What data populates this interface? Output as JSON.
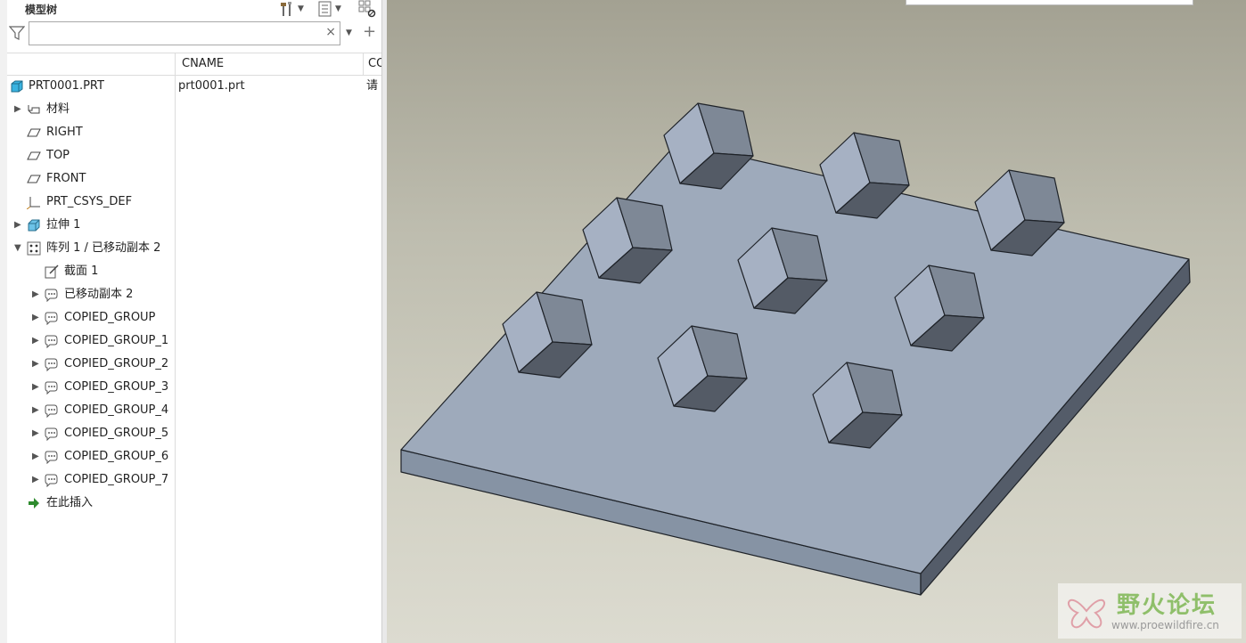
{
  "panel": {
    "title": "模型树"
  },
  "search": {
    "value": "",
    "placeholder": "",
    "clear": "×"
  },
  "columns": {
    "name": "",
    "cname": "CNAME",
    "third": "CO"
  },
  "tree": [
    {
      "label": "PRT0001.PRT",
      "cname": "prt0001.prt",
      "c2": "请",
      "icon": "part-icon",
      "indent": 0,
      "toggle": ""
    },
    {
      "label": "材料",
      "icon": "material-icon",
      "indent": 1,
      "toggle": "▶"
    },
    {
      "label": "RIGHT",
      "icon": "datum-plane-icon",
      "indent": 1,
      "toggle": ""
    },
    {
      "label": "TOP",
      "icon": "datum-plane-icon",
      "indent": 1,
      "toggle": ""
    },
    {
      "label": "FRONT",
      "icon": "datum-plane-icon",
      "indent": 1,
      "toggle": ""
    },
    {
      "label": "PRT_CSYS_DEF",
      "icon": "csys-icon",
      "indent": 1,
      "toggle": ""
    },
    {
      "label": "拉伸 1",
      "icon": "extrude-icon",
      "indent": 1,
      "toggle": "▶"
    },
    {
      "label": "阵列 1 / 已移动副本 2",
      "icon": "pattern-icon",
      "indent": 1,
      "toggle": "▼"
    },
    {
      "label": "截面 1",
      "icon": "sketch-icon",
      "indent": 2,
      "toggle": ""
    },
    {
      "label": "已移动副本 2",
      "icon": "group-icon",
      "indent": 2,
      "toggle": "▶"
    },
    {
      "label": "COPIED_GROUP",
      "icon": "group-icon",
      "indent": 2,
      "toggle": "▶"
    },
    {
      "label": "COPIED_GROUP_1",
      "icon": "group-icon",
      "indent": 2,
      "toggle": "▶"
    },
    {
      "label": "COPIED_GROUP_2",
      "icon": "group-icon",
      "indent": 2,
      "toggle": "▶"
    },
    {
      "label": "COPIED_GROUP_3",
      "icon": "group-icon",
      "indent": 2,
      "toggle": "▶"
    },
    {
      "label": "COPIED_GROUP_4",
      "icon": "group-icon",
      "indent": 2,
      "toggle": "▶"
    },
    {
      "label": "COPIED_GROUP_5",
      "icon": "group-icon",
      "indent": 2,
      "toggle": "▶"
    },
    {
      "label": "COPIED_GROUP_6",
      "icon": "group-icon",
      "indent": 2,
      "toggle": "▶"
    },
    {
      "label": "COPIED_GROUP_7",
      "icon": "group-icon",
      "indent": 2,
      "toggle": "▶"
    },
    {
      "label": "在此插入",
      "icon": "insert-here-icon",
      "indent": 1,
      "toggle": ""
    }
  ],
  "watermark": {
    "name": "野火论坛",
    "url": "www.proewildfire.cn"
  },
  "colors": {
    "plate_top": "#9eaabb",
    "plate_front": "#8693a4",
    "plate_side": "#545c69",
    "cube_left": "#a6b1c3",
    "cube_right": "#7e8896",
    "cube_bottom": "#545b66"
  }
}
